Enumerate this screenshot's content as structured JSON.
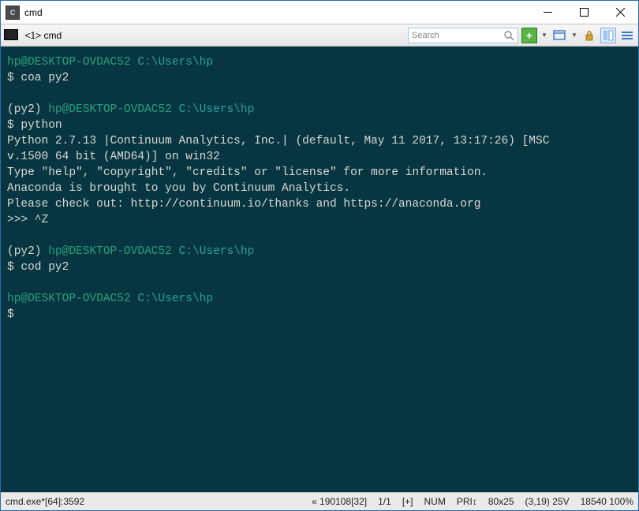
{
  "window": {
    "title": "cmd",
    "icon_glyph": "C"
  },
  "tab": {
    "label": "<1> cmd"
  },
  "search": {
    "placeholder": "Search"
  },
  "terminal": {
    "line1": {
      "userhost": "hp@DESKTOP-OVDAC52",
      "path": "C:\\Users\\hp"
    },
    "line2": {
      "prompt": "$",
      "cmd": "coa py2"
    },
    "line3": {
      "env": "(py2)",
      "userhost": "hp@DESKTOP-OVDAC52",
      "path": "C:\\Users\\hp"
    },
    "line4": {
      "prompt": "$",
      "cmd": "python"
    },
    "out1": "Python 2.7.13 |Continuum Analytics, Inc.| (default, May 11 2017, 13:17:26) [MSC",
    "out2": "v.1500 64 bit (AMD64)] on win32",
    "out3": "Type \"help\", \"copyright\", \"credits\" or \"license\" for more information.",
    "out4": "Anaconda is brought to you by Continuum Analytics.",
    "out5": "Please check out: http://continuum.io/thanks and https://anaconda.org",
    "out6": ">>> ^Z",
    "line5": {
      "env": "(py2)",
      "userhost": "hp@DESKTOP-OVDAC52",
      "path": "C:\\Users\\hp"
    },
    "line6": {
      "prompt": "$",
      "cmd": "cod py2"
    },
    "line7": {
      "userhost": "hp@DESKTOP-OVDAC52",
      "path": "C:\\Users\\hp"
    },
    "line8": {
      "prompt": "$"
    }
  },
  "status": {
    "left": "cmd.exe*[64]:3592",
    "seg1": "« 190108[32]",
    "seg2": "1/1",
    "seg3": "[+]",
    "seg4": "NUM",
    "seg5": "PRI↕",
    "seg6": "80x25",
    "seg7": "(3,19) 25V",
    "seg8": "18540 100%"
  }
}
